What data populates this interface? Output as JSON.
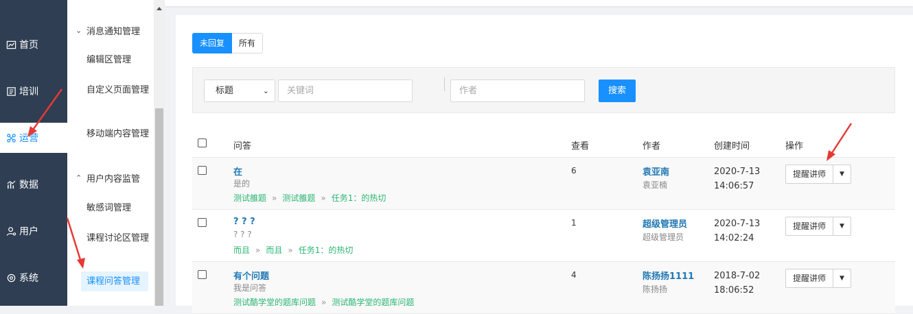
{
  "main_nav": [
    {
      "label": "首页",
      "icon": "chart-line-icon"
    },
    {
      "label": "培训",
      "icon": "book-icon"
    },
    {
      "label": "运营",
      "icon": "cluster-icon",
      "active": true
    },
    {
      "label": "数据",
      "icon": "bar-chart-icon"
    },
    {
      "label": "用户",
      "icon": "user-icon"
    },
    {
      "label": "系统",
      "icon": "gear-icon"
    }
  ],
  "sub_nav": {
    "group1": "消息通知管理",
    "items1": [
      "编辑区管理",
      "自定义页面管理",
      "移动端内容管理"
    ],
    "group2": "用户内容监管",
    "items2": [
      "敏感词管理",
      "课程讨论区管理",
      "课程问答管理"
    ]
  },
  "tabs": [
    "未回复",
    "所有"
  ],
  "filter": {
    "select_value": "标题",
    "keyword_placeholder": "关键词",
    "author_placeholder": "作者",
    "search_label": "搜索"
  },
  "table": {
    "headers": [
      "问答",
      "查看",
      "作者",
      "创建时间",
      "操作"
    ],
    "rows": [
      {
        "title": "在",
        "desc": "是的",
        "crumbs": [
          "测试雒题",
          "测试雒题",
          "任务1：的热切"
        ],
        "views": "6",
        "author": "袁亚南",
        "author_sub": "袁亚楠",
        "date": "2020-7-13 14:06:57",
        "action": "提醒讲师"
      },
      {
        "title": "? ? ?",
        "desc": "? ? ?",
        "crumbs": [
          "而且",
          "而且",
          "任务1：的热切"
        ],
        "views": "1",
        "author": "超级管理员",
        "author_sub": "超级管理员",
        "date": "2020-7-13 14:02:24",
        "action": "提醒讲师"
      },
      {
        "title": "有个问题",
        "desc": "我是问答",
        "crumbs": [
          "测试酷学堂的题库问题",
          "测试酷学堂的题库问题"
        ],
        "views": "4",
        "author": "陈扬扬1111",
        "author_sub": "陈扬扬",
        "date": "2018-7-02 18:06:52",
        "action": "提醒讲师"
      }
    ]
  },
  "colors": {
    "primary": "#1890ff",
    "nav_bg": "#2f3e52",
    "crumb": "#2bb673",
    "arrow": "#e53935"
  }
}
